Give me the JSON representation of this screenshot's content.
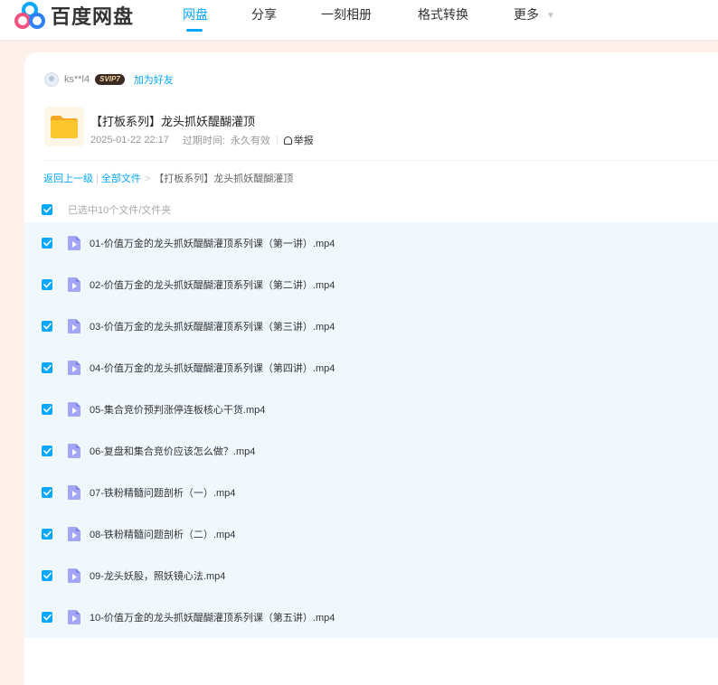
{
  "brand": {
    "name": "百度网盘"
  },
  "nav": {
    "items": [
      {
        "label": "网盘",
        "active": true
      },
      {
        "label": "分享",
        "active": false
      },
      {
        "label": "一刻相册",
        "active": false
      },
      {
        "label": "格式转换",
        "active": false
      },
      {
        "label": "更多",
        "active": false
      }
    ]
  },
  "sharer": {
    "username": "ks**l4",
    "badge": "SVIP7",
    "add_friend": "加为好友"
  },
  "share": {
    "title": "【打板系列】龙头抓妖醍醐灌顶",
    "date": "2025-01-22 22:17",
    "expiry_label": "过期时间:",
    "expiry_value": "永久有效",
    "report": "举报"
  },
  "breadcrumb": {
    "back": "返回上一级",
    "all_files": "全部文件",
    "current": "【打板系列】龙头抓妖醍醐灌顶"
  },
  "selection": {
    "text": "已选中10个文件/文件夹"
  },
  "files": [
    {
      "name": "01-价值万金的龙头抓妖醍醐灌顶系列课（第一讲）.mp4",
      "checked": true
    },
    {
      "name": "02-价值万金的龙头抓妖醍醐灌顶系列课（第二讲）.mp4",
      "checked": true
    },
    {
      "name": "03-价值万金的龙头抓妖醍醐灌顶系列课（第三讲）.mp4",
      "checked": true
    },
    {
      "name": "04-价值万金的龙头抓妖醍醐灌顶系列课（第四讲）.mp4",
      "checked": true
    },
    {
      "name": "05-集合竞价预判涨停连板核心干货.mp4",
      "checked": true
    },
    {
      "name": "06-复盘和集合竞价应该怎么做？.mp4",
      "checked": true
    },
    {
      "name": "07-铁粉精髓问题剖析（一）.mp4",
      "checked": true
    },
    {
      "name": "08-铁粉精髓问题剖析（二）.mp4",
      "checked": true
    },
    {
      "name": "09-龙头妖股，照妖镜心法.mp4",
      "checked": true
    },
    {
      "name": "10-价值万金的龙头抓妖醍醐灌顶系列课（第五讲）.mp4",
      "checked": true
    }
  ],
  "colors": {
    "accent": "#06a7ff",
    "page_bg": "#fdf1ea",
    "list_bg": "#f0f8fe",
    "video_icon": "#8f8ff6",
    "folder": "#fcc62d"
  },
  "icons": {
    "logo": "baidu-netdisk-logo",
    "caret": "chevron-down-icon",
    "folder": "folder-icon",
    "video": "video-file-icon",
    "check": "checkbox-checked-icon",
    "report": "report-icon"
  }
}
